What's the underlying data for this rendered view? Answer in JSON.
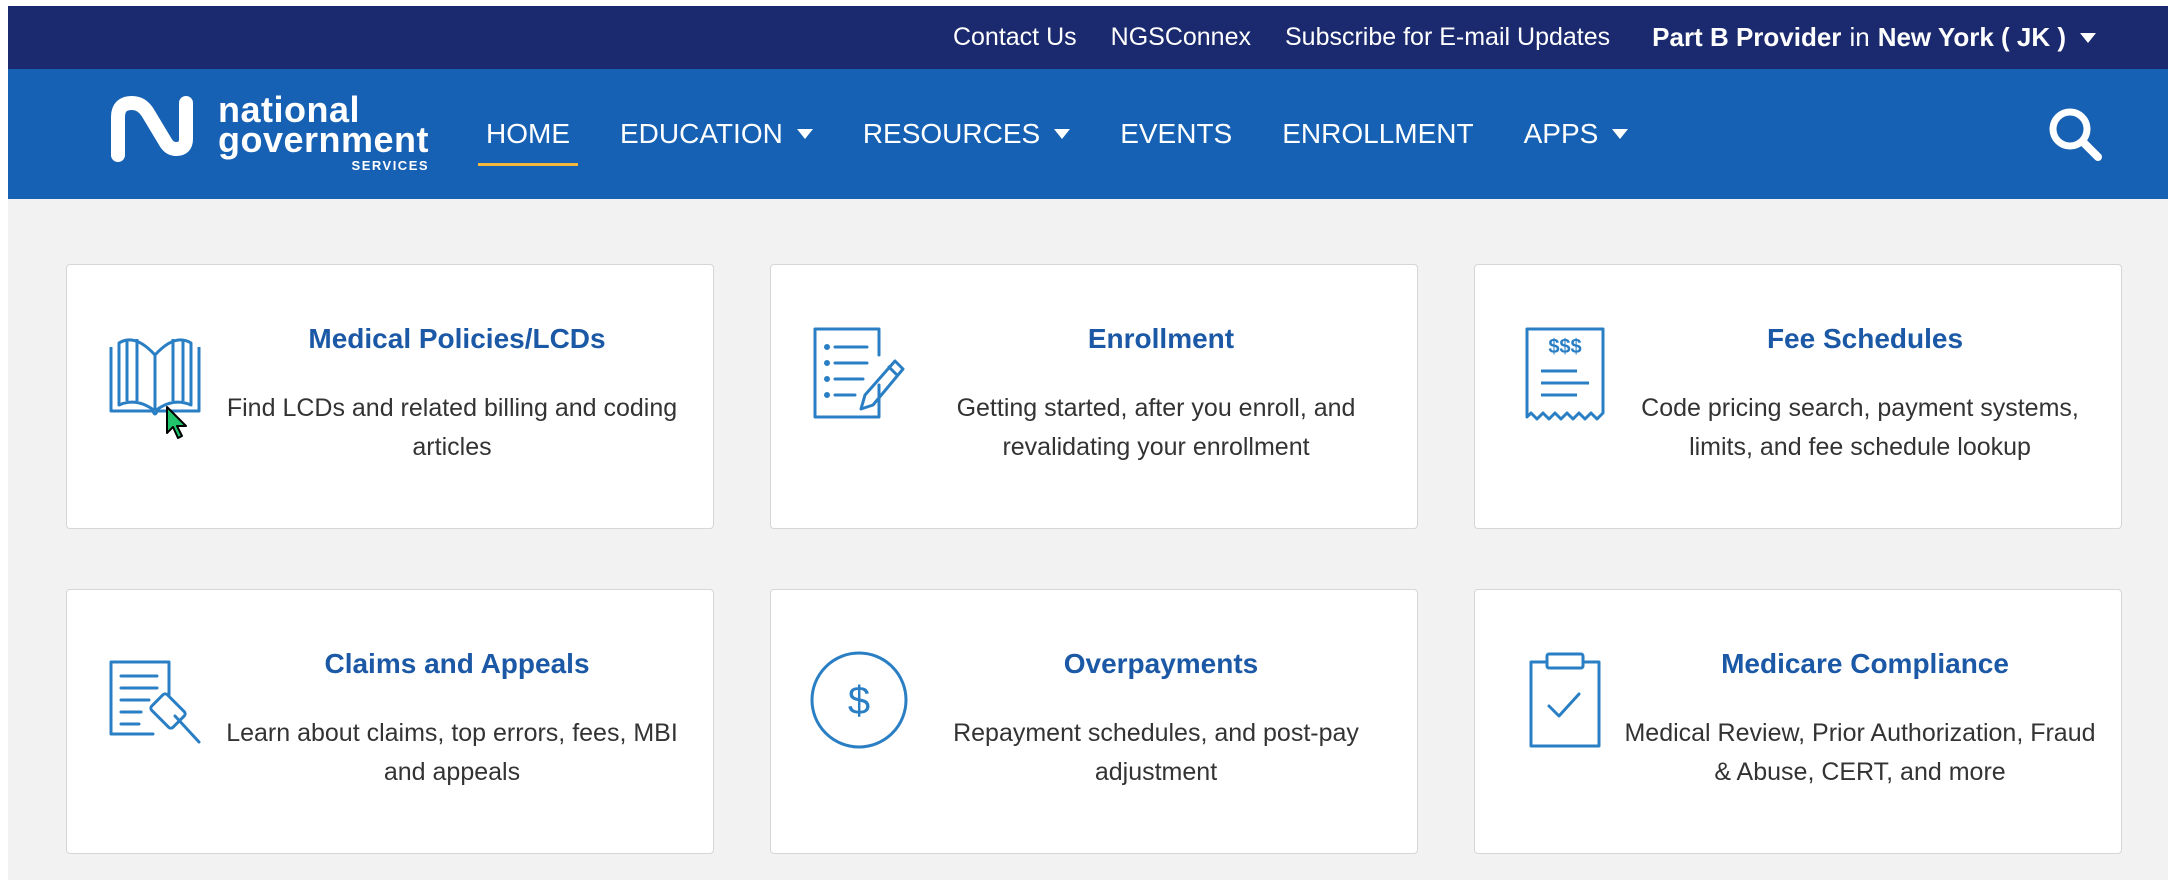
{
  "utility": {
    "links": [
      "Contact Us",
      "NGSConnex",
      "Subscribe for E-mail Updates"
    ],
    "region": {
      "role": "Part B Provider",
      "in": "in",
      "state": "New York ( JK )"
    }
  },
  "logo": {
    "line1": "national",
    "line2": "government",
    "line3": "SERVICES"
  },
  "nav": {
    "items": [
      {
        "label": "HOME",
        "active": true
      },
      {
        "label": "EDUCATION",
        "dropdown": true
      },
      {
        "label": "RESOURCES",
        "dropdown": true
      },
      {
        "label": "EVENTS"
      },
      {
        "label": "ENROLLMENT"
      },
      {
        "label": "APPS",
        "dropdown": true
      }
    ],
    "search_icon": "search-icon"
  },
  "cards": [
    {
      "title": "Medical Policies/LCDs",
      "desc": "Find LCDs and related billing and coding articles",
      "icon": "book-icon"
    },
    {
      "title": "Enrollment",
      "desc": "Getting started, after you enroll, and revalidating your enrollment",
      "icon": "document-pen-icon"
    },
    {
      "title": "Fee Schedules",
      "desc": "Code pricing search, payment systems, limits, and fee schedule lookup",
      "icon": "receipt-icon"
    },
    {
      "title": "Claims and Appeals",
      "desc": "Learn about claims, top errors, fees, MBI and appeals",
      "icon": "gavel-document-icon"
    },
    {
      "title": "Overpayments",
      "desc": "Repayment schedules, and post-pay adjustment",
      "icon": "dollar-circle-icon"
    },
    {
      "title": "Medicare Compliance",
      "desc": "Medical Review, Prior Authorization, Fraud & Abuse, CERT, and more",
      "icon": "clipboard-check-icon"
    }
  ],
  "colors": {
    "utility_bar": "#1b2a6e",
    "nav_bar": "#1661b3",
    "active_underline": "#f3b73b",
    "card_title": "#1b58a5",
    "icon_blue": "#2a7fc4"
  }
}
